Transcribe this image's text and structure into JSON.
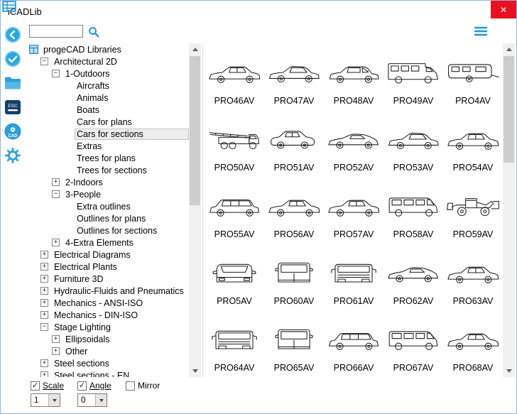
{
  "window": {
    "title": "iCADLib",
    "close_glyph": "✕"
  },
  "search": {
    "value": "",
    "placeholder": ""
  },
  "tree_items": [
    {
      "label": "progeCAD Libraries",
      "level": 0,
      "expander": "none",
      "icon": "libraries"
    },
    {
      "label": "Architectural 2D",
      "level": 1,
      "expander": "minus"
    },
    {
      "label": "1-Outdoors",
      "level": 2,
      "expander": "minus"
    },
    {
      "label": "Aircrafts",
      "level": 3,
      "expander": "leaf"
    },
    {
      "label": "Animals",
      "level": 3,
      "expander": "leaf"
    },
    {
      "label": "Boats",
      "level": 3,
      "expander": "leaf"
    },
    {
      "label": "Cars for plans",
      "level": 3,
      "expander": "leaf"
    },
    {
      "label": "Cars for sections",
      "level": 3,
      "expander": "leaf",
      "selected": true
    },
    {
      "label": "Extras",
      "level": 3,
      "expander": "leaf"
    },
    {
      "label": "Trees for plans",
      "level": 3,
      "expander": "leaf"
    },
    {
      "label": "Trees for sections",
      "level": 3,
      "expander": "leaf"
    },
    {
      "label": "2-Indoors",
      "level": 2,
      "expander": "plus"
    },
    {
      "label": "3-People",
      "level": 2,
      "expander": "minus"
    },
    {
      "label": "Extra outlines",
      "level": 3,
      "expander": "leaf"
    },
    {
      "label": "Outlines for plans",
      "level": 3,
      "expander": "leaf"
    },
    {
      "label": "Outlines for sections",
      "level": 3,
      "expander": "leaf"
    },
    {
      "label": "4-Extra Elements",
      "level": 2,
      "expander": "plus"
    },
    {
      "label": "Electrical Diagrams",
      "level": 1,
      "expander": "plus"
    },
    {
      "label": "Electrical Plants",
      "level": 1,
      "expander": "plus"
    },
    {
      "label": "Furniture 3D",
      "level": 1,
      "expander": "plus"
    },
    {
      "label": "Hydraulic-Fluids and Pneumatics",
      "level": 1,
      "expander": "plus"
    },
    {
      "label": "Mechanics - ANSI-ISO",
      "level": 1,
      "expander": "plus"
    },
    {
      "label": "Mechanics - DIN-ISO",
      "level": 1,
      "expander": "plus"
    },
    {
      "label": "Stage Lighting",
      "level": 1,
      "expander": "minus"
    },
    {
      "label": "Ellipsoidals",
      "level": 2,
      "expander": "plus"
    },
    {
      "label": "Other",
      "level": 2,
      "expander": "plus"
    },
    {
      "label": "Steel sections",
      "level": 1,
      "expander": "plus"
    },
    {
      "label": "Steel sections - EN",
      "level": 1,
      "expander": "plus"
    }
  ],
  "thumbnails": [
    {
      "label": "PRO46AV",
      "shape": "sedan-side"
    },
    {
      "label": "PRO47AV",
      "shape": "coupe-side"
    },
    {
      "label": "PRO48AV",
      "shape": "hatchback-side"
    },
    {
      "label": "PRO49AV",
      "shape": "rv-side"
    },
    {
      "label": "PRO4AV",
      "shape": "caravan-side"
    },
    {
      "label": "PRO50AV",
      "shape": "ladder-truck-side"
    },
    {
      "label": "PRO51AV",
      "shape": "mini-side"
    },
    {
      "label": "PRO52AV",
      "shape": "sports-side"
    },
    {
      "label": "PRO53AV",
      "shape": "coupe-side"
    },
    {
      "label": "PRO54AV",
      "shape": "sedan-side"
    },
    {
      "label": "PRO55AV",
      "shape": "wagon-side"
    },
    {
      "label": "PRO56AV",
      "shape": "sedan-side"
    },
    {
      "label": "PRO57AV",
      "shape": "sedan-side"
    },
    {
      "label": "PRO58AV",
      "shape": "van-side"
    },
    {
      "label": "PRO59AV",
      "shape": "loader-side"
    },
    {
      "label": "PRO5AV",
      "shape": "car-rear"
    },
    {
      "label": "PRO60AV",
      "shape": "van-rear"
    },
    {
      "label": "PRO61AV",
      "shape": "truck-front"
    },
    {
      "label": "PRO62AV",
      "shape": "sports-side"
    },
    {
      "label": "PRO63AV",
      "shape": "sedan-side"
    },
    {
      "label": "PRO64AV",
      "shape": "truck-front"
    },
    {
      "label": "PRO65AV",
      "shape": "van-rear"
    },
    {
      "label": "PRO66AV",
      "shape": "wagon-side"
    },
    {
      "label": "PRO67AV",
      "shape": "van-side"
    },
    {
      "label": "PRO68AV",
      "shape": "sedan-side"
    }
  ],
  "footer": {
    "scale": {
      "label": "Scale",
      "checked": true,
      "value": "1"
    },
    "angle": {
      "label": "Angle",
      "checked": true,
      "value": "0"
    },
    "mirror": {
      "label": "Mirror",
      "checked": false
    }
  },
  "colors": {
    "accent": "#2196d9",
    "close": "#e81123",
    "selection": "#ededed"
  }
}
